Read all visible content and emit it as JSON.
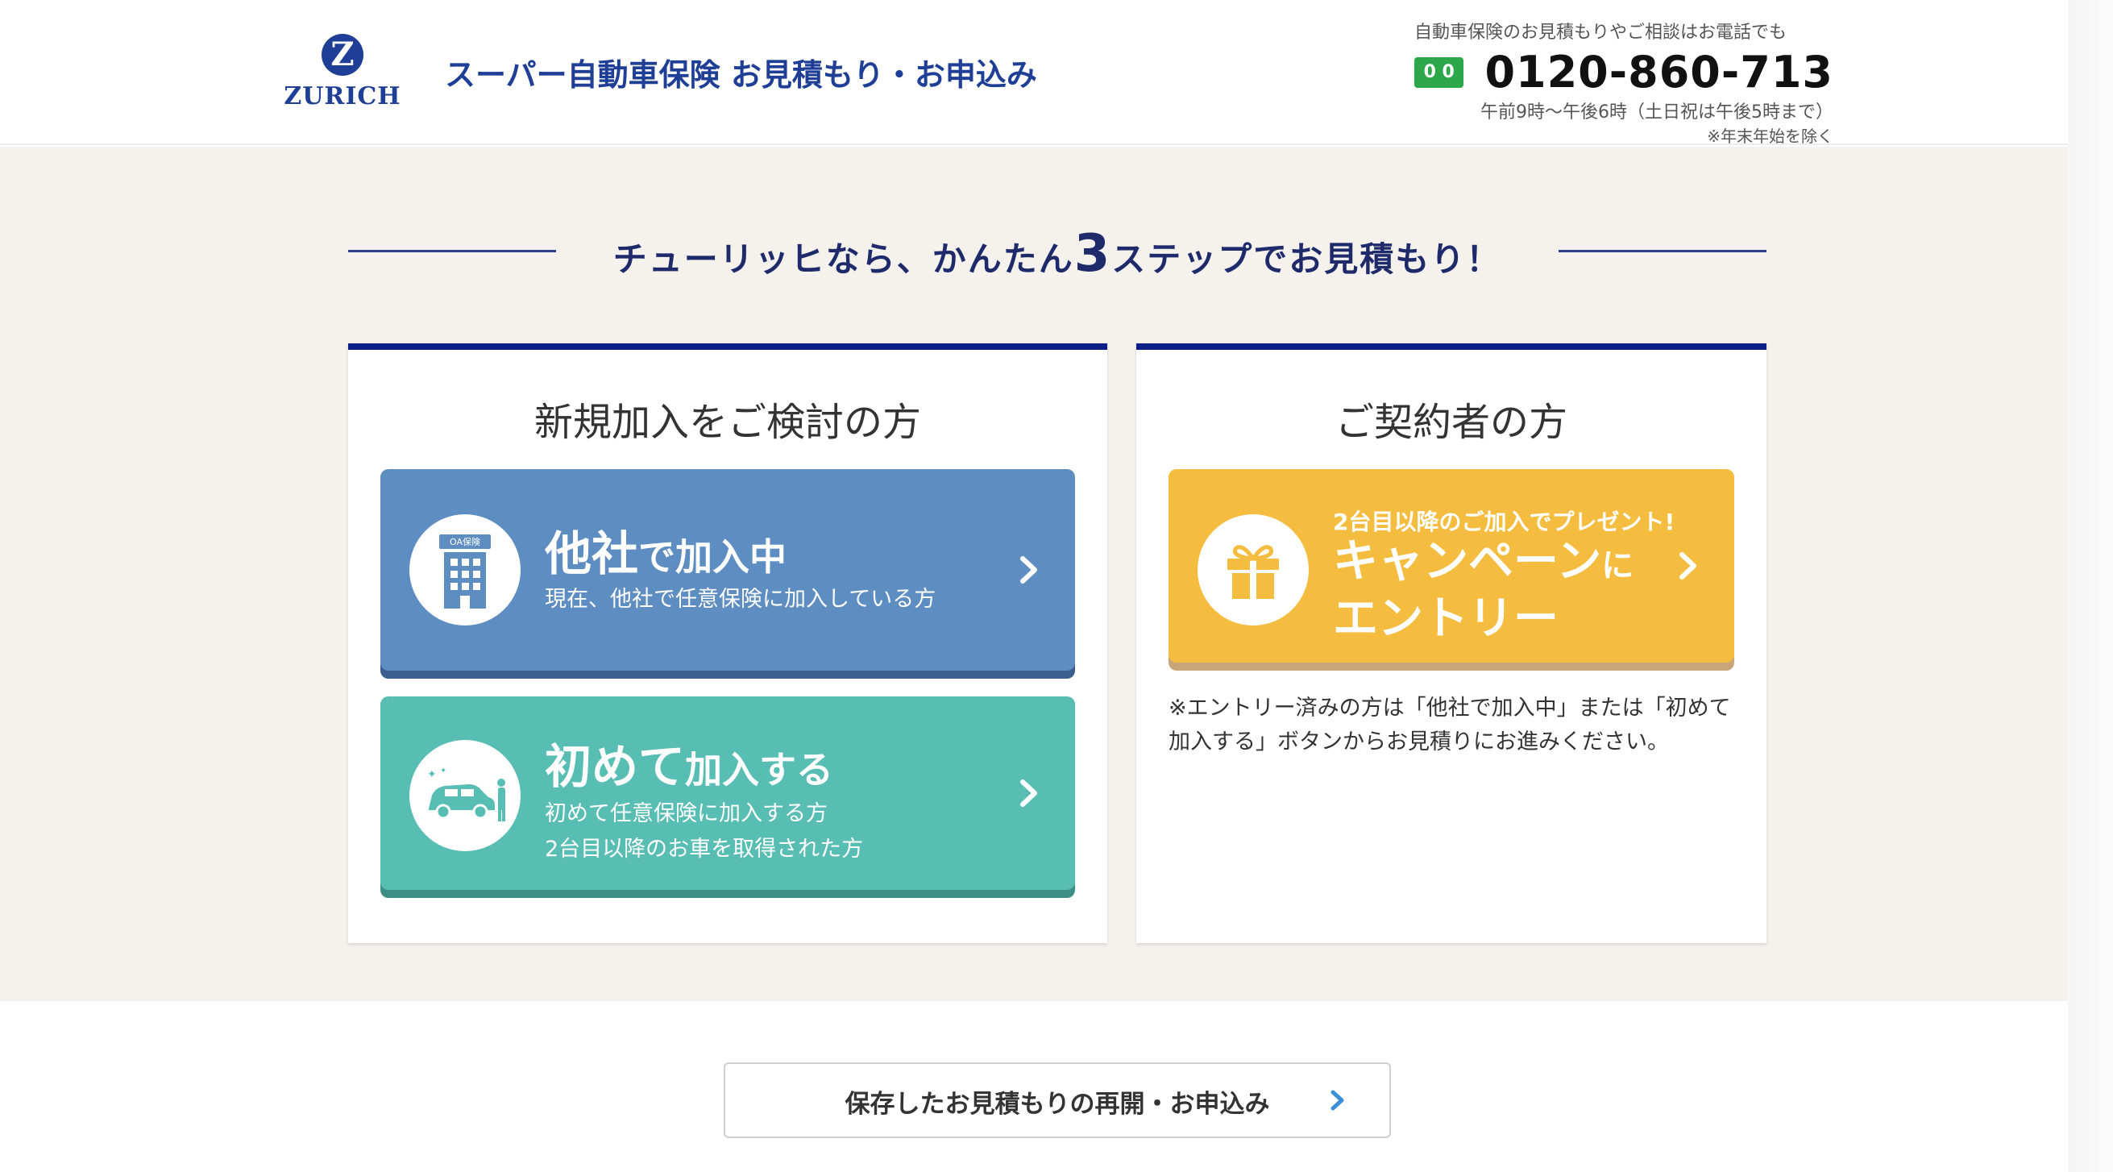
{
  "header": {
    "logo_mark": "Z",
    "logo_text": "ZURICH",
    "title": "スーパー自動車保険 お見積もり・お申込み",
    "contact_note": "自動車保険のお見積もりやご相談はお電話でも",
    "freedial_label": "0 0",
    "phone": "0120-860-713",
    "hours": "午前9時〜午後6時（土日祝は午後5時まで）",
    "holiday_note": "※年末年始を除く"
  },
  "tagline": {
    "before": "チューリッヒなら、かんたん",
    "number": "3",
    "after": "ステップでお見積もり！"
  },
  "new_card": {
    "title": "新規加入をご検討の方",
    "other_company": {
      "head_lg": "他社",
      "head_sm": "で加入中",
      "sub": "現在、他社で任意保険に加入している方",
      "building_sign": "OA保険"
    },
    "first_time": {
      "head_lg": "初めて",
      "head_sm": "加入する",
      "sub1": "初めて任意保険に加入する方",
      "sub2": "2台目以降のお車を取得された方"
    }
  },
  "existing_card": {
    "title": "ご契約者の方",
    "campaign": {
      "tag": "2台目以降のご加入でプレゼント!",
      "line1": "キャンペーン",
      "line1_suffix": "に",
      "line2": "エントリー"
    },
    "note": "※エントリー済みの方は「他社で加入中」または「初めて加入する」ボタンからお見積りにお進みください。"
  },
  "resume": {
    "label": "保存したお見積もりの再開・お申込み"
  },
  "colors": {
    "brand": "#1f3f96",
    "blue_button": "#5e8dc2",
    "green_button": "#58bdb3",
    "yellow_button": "#f5bd3f",
    "card_border": "#0c1f86"
  }
}
